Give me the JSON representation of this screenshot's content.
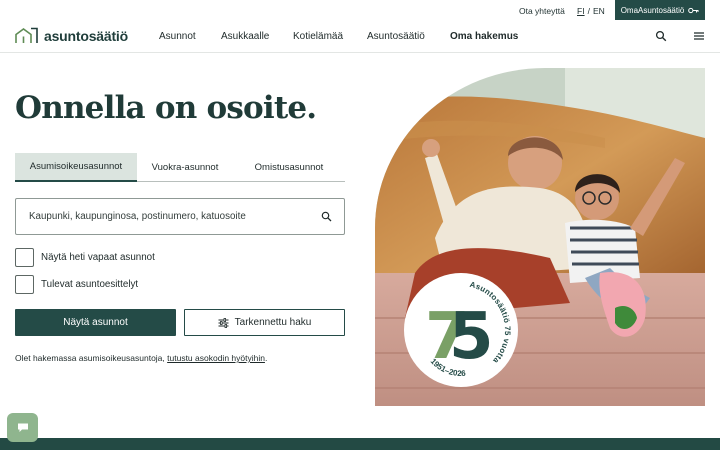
{
  "util": {
    "contact": "Ota yhteyttä",
    "lang_fi": "FI",
    "lang_sep": "/",
    "lang_en": "EN",
    "oma_button": "OmaAsuntosäätiö"
  },
  "header": {
    "logo_text": "asuntosäätiö",
    "nav": [
      "Asunnot",
      "Asukkaalle",
      "Kotielämää",
      "Asuntosäätiö",
      "Oma hakemus"
    ]
  },
  "hero": {
    "title": "Onnella on osoite."
  },
  "tabs": [
    "Asumisoikeusasunnot",
    "Vuokra-asunnot",
    "Omistusasunnot"
  ],
  "search": {
    "placeholder": "Kaupunki, kaupunginosa, postinumero, katuosoite"
  },
  "filters": {
    "available_now": "Näytä heti vapaat asunnot",
    "upcoming_showings": "Tulevat asuntoesittelyt"
  },
  "actions": {
    "show_homes": "Näytä asunnot",
    "advanced_search": "Tarkennettu haku"
  },
  "info": {
    "text": "Olet hakemassa asumisoikeusasuntoja, ",
    "link": "tutustu asokodin hyötyihin",
    "end": "."
  },
  "badge": {
    "number_7": "7",
    "number_5": "5",
    "ring_text": "Asuntosäätiö 75 vuotta",
    "years": "1951–2026"
  },
  "colors": {
    "brand": "#244b47",
    "tab_active_bg": "#dbe4df",
    "chat": "#8fb58e",
    "badge_seven": "#7aa066"
  }
}
